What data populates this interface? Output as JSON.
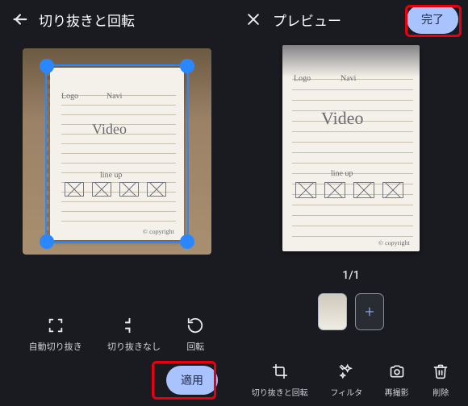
{
  "left": {
    "title": "切り抜きと回転",
    "tools": {
      "auto_crop": "自動切り抜き",
      "no_crop": "切り抜きなし",
      "rotate": "回転"
    },
    "apply_label": "適用"
  },
  "right": {
    "title": "プレビュー",
    "done_label": "完了",
    "page_counter": "1/1",
    "tools": {
      "crop_rotate": "切り抜きと回転",
      "filter": "フィルタ",
      "retake": "再撮影",
      "delete": "削除"
    }
  },
  "notepad_sketch": {
    "logo": "Logo",
    "navi": "Navi",
    "video": "Video",
    "lineup": "line up",
    "copyright": "© copyright"
  }
}
